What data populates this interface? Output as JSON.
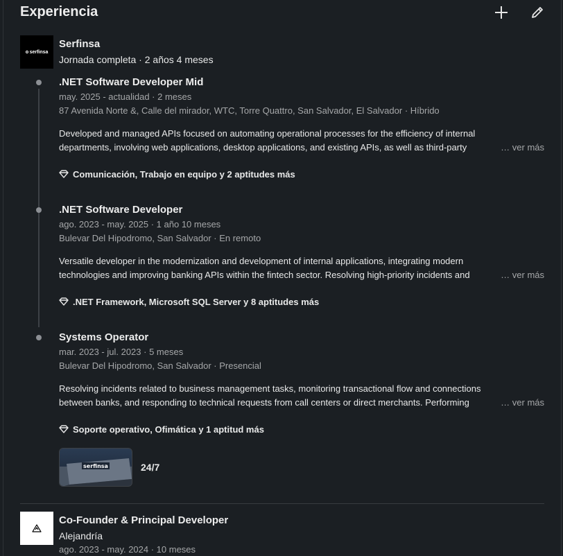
{
  "section": {
    "title": "Experiencia"
  },
  "header": {
    "add_icon": "plus-icon",
    "edit_icon": "pencil-icon"
  },
  "company": {
    "name": "Serfinsa",
    "logo_text": "serfinsa",
    "meta": "Jornada completa · 2 años 4 meses"
  },
  "roles": [
    {
      "title": ".NET Software Developer Mid",
      "dates": "may. 2025 - actualidad · 2 meses",
      "location": " 87 Avenida Norte &, Calle del mirador, WTC, Torre Quattro, San Salvador, El Salvador · Híbrido",
      "description": "Developed and managed APIs focused on automating operational processes for the efficiency of internal departments, involving web applications, desktop applications, and existing APIs, as well as third-party",
      "see_more": "… ver más",
      "skills": "Comunicación, Trabajo en equipo y 2 aptitudes más"
    },
    {
      "title": ".NET Software Developer",
      "dates": "ago. 2023 - may. 2025 · 1 año 10 meses",
      "location": "Bulevar Del Hipodromo, San Salvador · En remoto",
      "description": "Versatile developer in the modernization and development of internal applications, integrating modern technologies and improving banking APIs within the fintech sector. Resolving high-priority incidents and",
      "see_more": "… ver más",
      "skills": ".NET Framework, Microsoft SQL Server y 8 aptitudes más"
    },
    {
      "title": "Systems Operator",
      "dates": "mar. 2023 - jul. 2023 · 5 meses",
      "location": "Bulevar Del Hipodromo, San Salvador · Presencial",
      "description": "Resolving incidents related to business management tasks, monitoring transactional flow and connections between banks, and responding to technical requests from call centers or direct merchants. Performing",
      "see_more": "… ver más",
      "skills": "Soporte operativo, Ofimática y 1 aptitud más"
    }
  ],
  "media": {
    "label": "24/7",
    "sign_text": "serfinsa"
  },
  "company2": {
    "title": "Co-Founder & Principal Developer",
    "name": "Alejandría",
    "dates": "ago. 2023 - may. 2024 · 10 meses"
  },
  "colors": {
    "background": "#1b1f23",
    "text_primary": "#e8e8e8",
    "text_secondary": "#9a9c9e",
    "timeline": "#3d4146"
  }
}
